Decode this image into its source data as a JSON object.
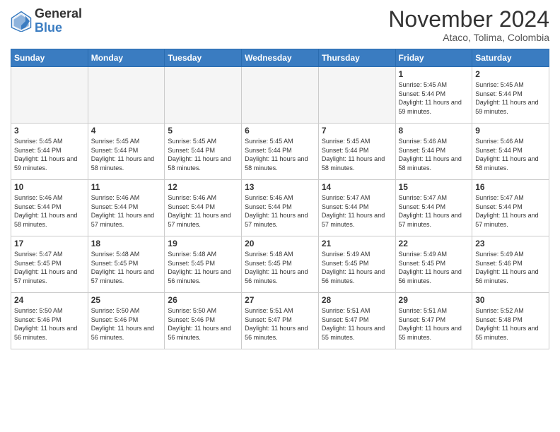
{
  "logo": {
    "general": "General",
    "blue": "Blue"
  },
  "header": {
    "month": "November 2024",
    "location": "Ataco, Tolima, Colombia"
  },
  "weekdays": [
    "Sunday",
    "Monday",
    "Tuesday",
    "Wednesday",
    "Thursday",
    "Friday",
    "Saturday"
  ],
  "weeks": [
    [
      {
        "day": "",
        "sunrise": "",
        "sunset": "",
        "daylight": ""
      },
      {
        "day": "",
        "sunrise": "",
        "sunset": "",
        "daylight": ""
      },
      {
        "day": "",
        "sunrise": "",
        "sunset": "",
        "daylight": ""
      },
      {
        "day": "",
        "sunrise": "",
        "sunset": "",
        "daylight": ""
      },
      {
        "day": "",
        "sunrise": "",
        "sunset": "",
        "daylight": ""
      },
      {
        "day": "1",
        "sunrise": "Sunrise: 5:45 AM",
        "sunset": "Sunset: 5:44 PM",
        "daylight": "Daylight: 11 hours and 59 minutes."
      },
      {
        "day": "2",
        "sunrise": "Sunrise: 5:45 AM",
        "sunset": "Sunset: 5:44 PM",
        "daylight": "Daylight: 11 hours and 59 minutes."
      }
    ],
    [
      {
        "day": "3",
        "sunrise": "Sunrise: 5:45 AM",
        "sunset": "Sunset: 5:44 PM",
        "daylight": "Daylight: 11 hours and 59 minutes."
      },
      {
        "day": "4",
        "sunrise": "Sunrise: 5:45 AM",
        "sunset": "Sunset: 5:44 PM",
        "daylight": "Daylight: 11 hours and 58 minutes."
      },
      {
        "day": "5",
        "sunrise": "Sunrise: 5:45 AM",
        "sunset": "Sunset: 5:44 PM",
        "daylight": "Daylight: 11 hours and 58 minutes."
      },
      {
        "day": "6",
        "sunrise": "Sunrise: 5:45 AM",
        "sunset": "Sunset: 5:44 PM",
        "daylight": "Daylight: 11 hours and 58 minutes."
      },
      {
        "day": "7",
        "sunrise": "Sunrise: 5:45 AM",
        "sunset": "Sunset: 5:44 PM",
        "daylight": "Daylight: 11 hours and 58 minutes."
      },
      {
        "day": "8",
        "sunrise": "Sunrise: 5:46 AM",
        "sunset": "Sunset: 5:44 PM",
        "daylight": "Daylight: 11 hours and 58 minutes."
      },
      {
        "day": "9",
        "sunrise": "Sunrise: 5:46 AM",
        "sunset": "Sunset: 5:44 PM",
        "daylight": "Daylight: 11 hours and 58 minutes."
      }
    ],
    [
      {
        "day": "10",
        "sunrise": "Sunrise: 5:46 AM",
        "sunset": "Sunset: 5:44 PM",
        "daylight": "Daylight: 11 hours and 58 minutes."
      },
      {
        "day": "11",
        "sunrise": "Sunrise: 5:46 AM",
        "sunset": "Sunset: 5:44 PM",
        "daylight": "Daylight: 11 hours and 57 minutes."
      },
      {
        "day": "12",
        "sunrise": "Sunrise: 5:46 AM",
        "sunset": "Sunset: 5:44 PM",
        "daylight": "Daylight: 11 hours and 57 minutes."
      },
      {
        "day": "13",
        "sunrise": "Sunrise: 5:46 AM",
        "sunset": "Sunset: 5:44 PM",
        "daylight": "Daylight: 11 hours and 57 minutes."
      },
      {
        "day": "14",
        "sunrise": "Sunrise: 5:47 AM",
        "sunset": "Sunset: 5:44 PM",
        "daylight": "Daylight: 11 hours and 57 minutes."
      },
      {
        "day": "15",
        "sunrise": "Sunrise: 5:47 AM",
        "sunset": "Sunset: 5:44 PM",
        "daylight": "Daylight: 11 hours and 57 minutes."
      },
      {
        "day": "16",
        "sunrise": "Sunrise: 5:47 AM",
        "sunset": "Sunset: 5:44 PM",
        "daylight": "Daylight: 11 hours and 57 minutes."
      }
    ],
    [
      {
        "day": "17",
        "sunrise": "Sunrise: 5:47 AM",
        "sunset": "Sunset: 5:45 PM",
        "daylight": "Daylight: 11 hours and 57 minutes."
      },
      {
        "day": "18",
        "sunrise": "Sunrise: 5:48 AM",
        "sunset": "Sunset: 5:45 PM",
        "daylight": "Daylight: 11 hours and 57 minutes."
      },
      {
        "day": "19",
        "sunrise": "Sunrise: 5:48 AM",
        "sunset": "Sunset: 5:45 PM",
        "daylight": "Daylight: 11 hours and 56 minutes."
      },
      {
        "day": "20",
        "sunrise": "Sunrise: 5:48 AM",
        "sunset": "Sunset: 5:45 PM",
        "daylight": "Daylight: 11 hours and 56 minutes."
      },
      {
        "day": "21",
        "sunrise": "Sunrise: 5:49 AM",
        "sunset": "Sunset: 5:45 PM",
        "daylight": "Daylight: 11 hours and 56 minutes."
      },
      {
        "day": "22",
        "sunrise": "Sunrise: 5:49 AM",
        "sunset": "Sunset: 5:45 PM",
        "daylight": "Daylight: 11 hours and 56 minutes."
      },
      {
        "day": "23",
        "sunrise": "Sunrise: 5:49 AM",
        "sunset": "Sunset: 5:46 PM",
        "daylight": "Daylight: 11 hours and 56 minutes."
      }
    ],
    [
      {
        "day": "24",
        "sunrise": "Sunrise: 5:50 AM",
        "sunset": "Sunset: 5:46 PM",
        "daylight": "Daylight: 11 hours and 56 minutes."
      },
      {
        "day": "25",
        "sunrise": "Sunrise: 5:50 AM",
        "sunset": "Sunset: 5:46 PM",
        "daylight": "Daylight: 11 hours and 56 minutes."
      },
      {
        "day": "26",
        "sunrise": "Sunrise: 5:50 AM",
        "sunset": "Sunset: 5:46 PM",
        "daylight": "Daylight: 11 hours and 56 minutes."
      },
      {
        "day": "27",
        "sunrise": "Sunrise: 5:51 AM",
        "sunset": "Sunset: 5:47 PM",
        "daylight": "Daylight: 11 hours and 56 minutes."
      },
      {
        "day": "28",
        "sunrise": "Sunrise: 5:51 AM",
        "sunset": "Sunset: 5:47 PM",
        "daylight": "Daylight: 11 hours and 55 minutes."
      },
      {
        "day": "29",
        "sunrise": "Sunrise: 5:51 AM",
        "sunset": "Sunset: 5:47 PM",
        "daylight": "Daylight: 11 hours and 55 minutes."
      },
      {
        "day": "30",
        "sunrise": "Sunrise: 5:52 AM",
        "sunset": "Sunset: 5:48 PM",
        "daylight": "Daylight: 11 hours and 55 minutes."
      }
    ]
  ]
}
